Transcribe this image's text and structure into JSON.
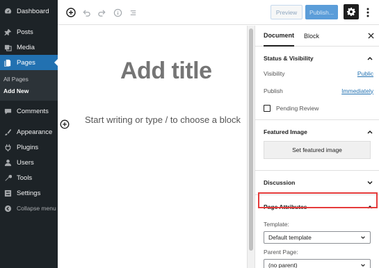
{
  "admin_menu": {
    "items": [
      {
        "label": "Dashboard",
        "icon": "dashboard-icon"
      },
      {
        "label": "Posts",
        "icon": "pin-icon"
      },
      {
        "label": "Media",
        "icon": "media-icon"
      },
      {
        "label": "Pages",
        "icon": "page-icon",
        "active": true
      }
    ],
    "submenu": [
      "All Pages",
      "Add New"
    ],
    "items_after": [
      {
        "label": "Comments",
        "icon": "comment-icon"
      },
      {
        "label": "Appearance",
        "icon": "brush-icon"
      },
      {
        "label": "Plugins",
        "icon": "plugin-icon"
      },
      {
        "label": "Users",
        "icon": "users-icon"
      },
      {
        "label": "Tools",
        "icon": "wrench-icon"
      },
      {
        "label": "Settings",
        "icon": "settings-icon"
      }
    ],
    "collapse_label": "Collapse menu"
  },
  "toolbar": {
    "preview_label": "Preview",
    "publish_label": "Publish..."
  },
  "editor": {
    "title_placeholder": "Add title",
    "block_placeholder": "Start writing or type / to choose a block"
  },
  "sidebar": {
    "tabs": [
      "Document",
      "Block"
    ],
    "close_icon": "close-icon",
    "status": {
      "heading": "Status & Visibility",
      "visibility_label": "Visibility",
      "visibility_value": "Public",
      "publish_label": "Publish",
      "publish_value": "Immediately",
      "pending_label": "Pending Review"
    },
    "featured": {
      "heading": "Featured Image",
      "button": "Set featured image"
    },
    "discussion": {
      "heading": "Discussion"
    },
    "page_attributes": {
      "heading": "Page Attributes",
      "template_label": "Template:",
      "template_value": "Default template",
      "parent_label": "Parent Page:",
      "parent_value": "(no parent)"
    }
  },
  "colors": {
    "admin_bg": "#1d2327",
    "accent": "#2271b1",
    "highlight": "#e53b3b"
  }
}
